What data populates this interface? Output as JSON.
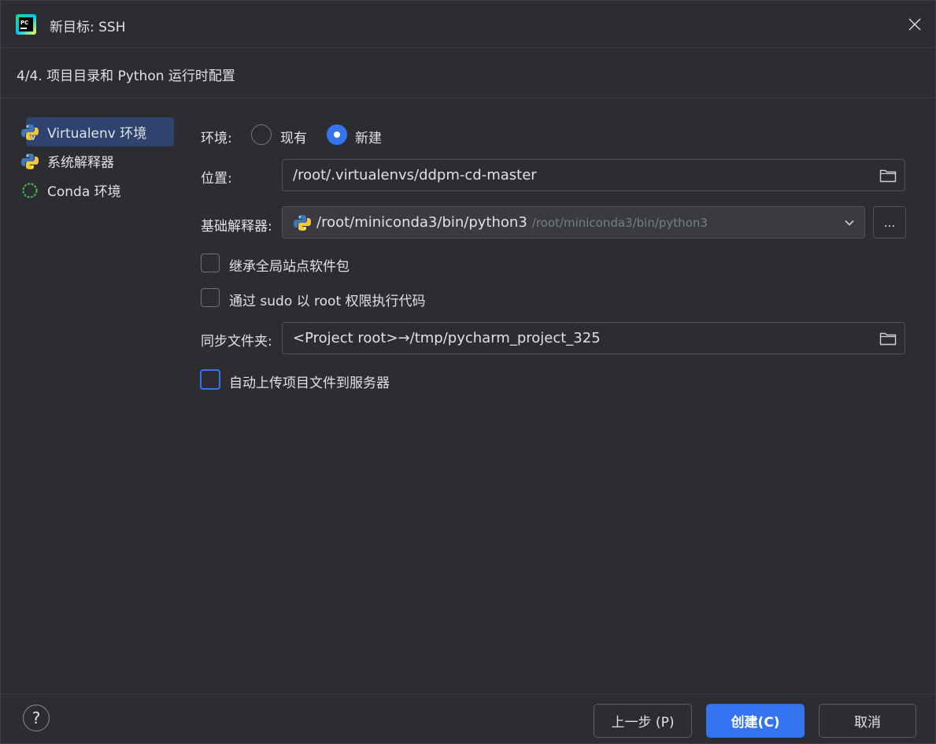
{
  "window": {
    "title": "新目标: SSH",
    "app_icon": "pycharm-logo",
    "close_icon": "close-icon"
  },
  "step": {
    "title": "4/4. 项目目录和 Python 运行时配置"
  },
  "sidebar": {
    "items": [
      {
        "label": "Virtualenv 环境",
        "icon": "virtualenv-icon",
        "selected": true
      },
      {
        "label": "系统解释器",
        "icon": "python-icon",
        "selected": false
      },
      {
        "label": "Conda 环境",
        "icon": "conda-icon",
        "selected": false
      }
    ]
  },
  "form": {
    "env_label": "环境:",
    "env_options": [
      {
        "label": "现有",
        "checked": false
      },
      {
        "label": "新建",
        "checked": true
      }
    ],
    "location_label": "位置:",
    "location_value": "/root/.virtualenvs/ddpm-cd-master",
    "base_interpreter_label": "基础解释器:",
    "base_interpreter_value": "/root/miniconda3/bin/python3",
    "base_interpreter_hint": "/root/miniconda3/bin/python3",
    "browse_label": "...",
    "inherit_label": "继承全局站点软件包",
    "inherit_checked": false,
    "sudo_label": "通过 sudo 以 root 权限执行代码",
    "sudo_checked": false,
    "sync_label": "同步文件夹:",
    "sync_value": "<Project root>→/tmp/pycharm_project_325",
    "autoupload_label": "自动上传项目文件到服务器",
    "autoupload_checked": false
  },
  "footer": {
    "help_label": "?",
    "prev_label": "上一步 (P)",
    "create_label": "创建(C)",
    "cancel_label": "取消"
  },
  "colors": {
    "background": "#2b2d30",
    "accent": "#3574f0",
    "selection": "#2e436e",
    "border": "#4e5157"
  }
}
